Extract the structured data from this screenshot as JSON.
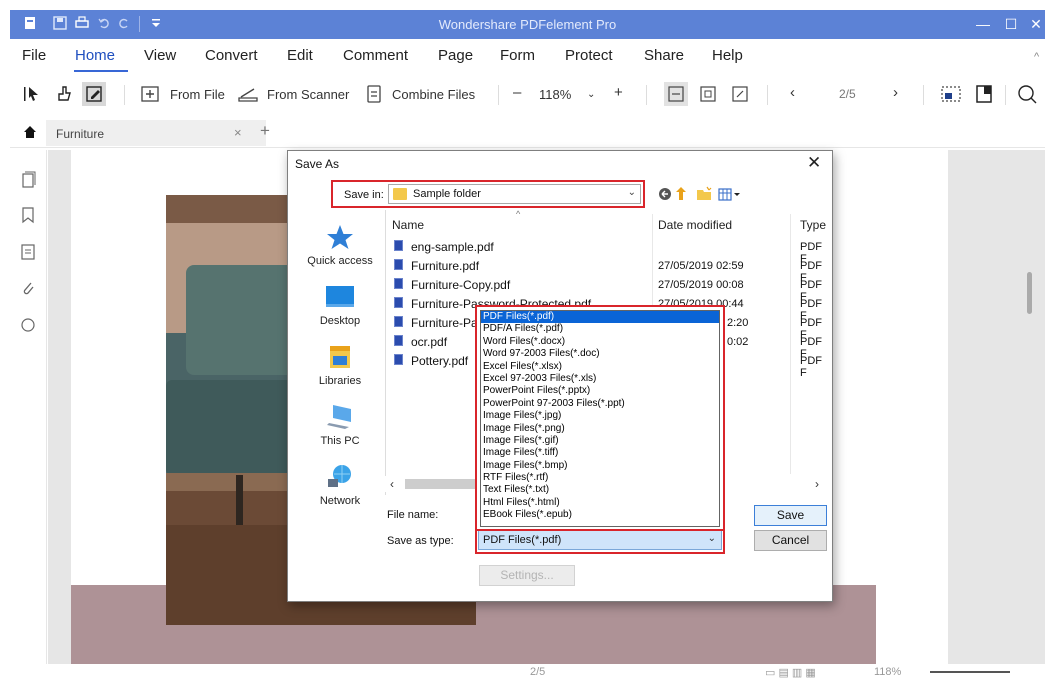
{
  "app": {
    "title": "Wondershare PDFelement Pro",
    "quick_access": [
      "file-menu-icon",
      "save-icon",
      "print-icon",
      "undo-icon",
      "redo-icon",
      "customize-icon"
    ]
  },
  "menu": {
    "items": [
      "File",
      "Home",
      "View",
      "Convert",
      "Edit",
      "Comment",
      "Page",
      "Form",
      "Protect",
      "Share",
      "Help"
    ],
    "active": "Home"
  },
  "toolbar": {
    "from_file": "From File",
    "from_scanner": "From Scanner",
    "combine_files": "Combine Files",
    "zoom_minus": "–",
    "zoom_value": "118%",
    "zoom_plus": "+",
    "page_prev": "‹",
    "page_indicator": "2/5",
    "page_next": "›"
  },
  "tab": {
    "label": "Furniture",
    "close": "×",
    "add": "+"
  },
  "dialog": {
    "title": "Save As",
    "close": "✕",
    "save_in_label": "Save in:",
    "save_in_value": "Sample folder",
    "places": [
      "Quick access",
      "Desktop",
      "Libraries",
      "This PC",
      "Network"
    ],
    "columns": {
      "name": "Name",
      "date": "Date modified",
      "type": "Type"
    },
    "files": [
      {
        "name": "eng-sample.pdf",
        "date": "",
        "type": "PDF F"
      },
      {
        "name": "Furniture.pdf",
        "date": "27/05/2019 02:59",
        "type": "PDF F"
      },
      {
        "name": "Furniture-Copy.pdf",
        "date": "27/05/2019 00:08",
        "type": "PDF F"
      },
      {
        "name": "Furniture-Password-Protected.pdf",
        "date": "27/05/2019 00:44",
        "type": "PDF F"
      },
      {
        "name": "Furniture-Pa",
        "date": "2:20",
        "type": "PDF F"
      },
      {
        "name": "ocr.pdf",
        "date": "0:02",
        "type": "PDF F"
      },
      {
        "name": "Pottery.pdf",
        "date": "",
        "type": "PDF F"
      }
    ],
    "file_name_label": "File name:",
    "save_as_type_label": "Save as type:",
    "save_as_type_value": "PDF Files(*.pdf)",
    "type_options": [
      "PDF Files(*.pdf)",
      "PDF/A Files(*.pdf)",
      "Word Files(*.docx)",
      "Word 97-2003 Files(*.doc)",
      "Excel Files(*.xlsx)",
      "Excel 97-2003 Files(*.xls)",
      "PowerPoint Files(*.pptx)",
      "PowerPoint 97-2003 Files(*.ppt)",
      "Image Files(*.jpg)",
      "Image Files(*.png)",
      "Image Files(*.gif)",
      "Image Files(*.tiff)",
      "Image Files(*.bmp)",
      "RTF Files(*.rtf)",
      "Text Files(*.txt)",
      "Html Files(*.html)",
      "EBook Files(*.epub)"
    ],
    "selected_option": "PDF Files(*.pdf)",
    "save_button": "Save",
    "cancel_button": "Cancel",
    "settings_button": "Settings..."
  },
  "statusbar": {
    "page": "2/5",
    "zoom": "118%"
  },
  "colors": {
    "titlebar": "#5c82d6",
    "highlight_red": "#d9252b",
    "selection_blue": "#0a64d6"
  }
}
